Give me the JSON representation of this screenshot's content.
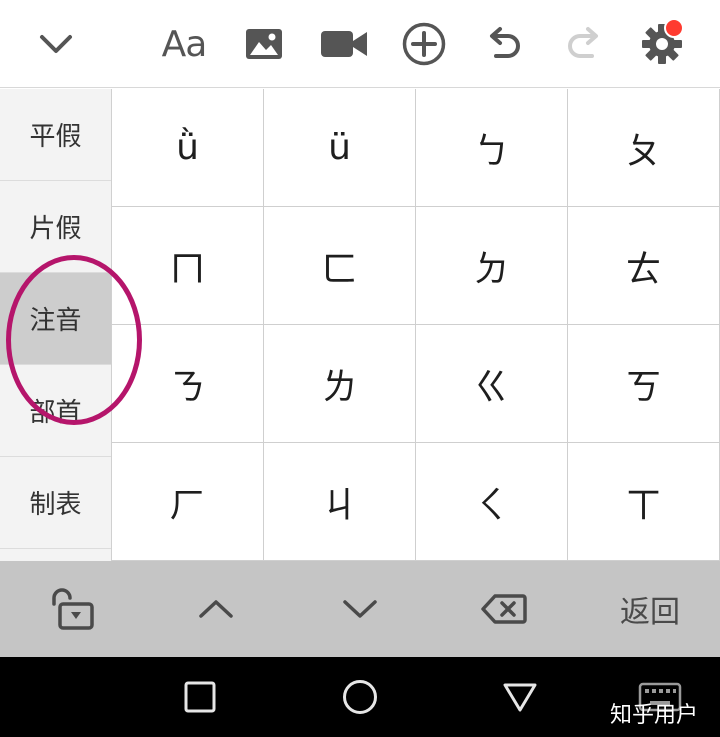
{
  "toolbar": {
    "font_label": "Aa",
    "badge_color": "#ff3b30",
    "icons": [
      "chevron-down-icon",
      "font-size-icon",
      "image-icon",
      "video-icon",
      "add-circle-icon",
      "undo-icon",
      "redo-icon",
      "settings-icon"
    ]
  },
  "categories": {
    "items": [
      {
        "label": "平假"
      },
      {
        "label": "片假"
      },
      {
        "label": "注音",
        "active": true
      },
      {
        "label": "部首"
      },
      {
        "label": "制表"
      }
    ]
  },
  "keys": [
    [
      "ǜ",
      "ü",
      "ㄅ",
      "ㄆ"
    ],
    [
      "ㄇ",
      "ㄈ",
      "ㄉ",
      "ㄊ"
    ],
    [
      "ㄋ",
      "ㄌ",
      "ㄍ",
      "ㄎ"
    ],
    [
      "ㄏ",
      "ㄐ",
      "ㄑ",
      "ㄒ"
    ]
  ],
  "actionbar": {
    "return_label": "返回",
    "icons": [
      "unlock-icon",
      "chevron-up-icon",
      "chevron-down-icon",
      "backspace-icon"
    ]
  },
  "navbar": {
    "icons": [
      "recents-square-icon",
      "home-circle-icon",
      "back-triangle-icon",
      "keyboard-icon"
    ]
  },
  "watermark": "知乎用户",
  "annotation_color": "#b5156b"
}
